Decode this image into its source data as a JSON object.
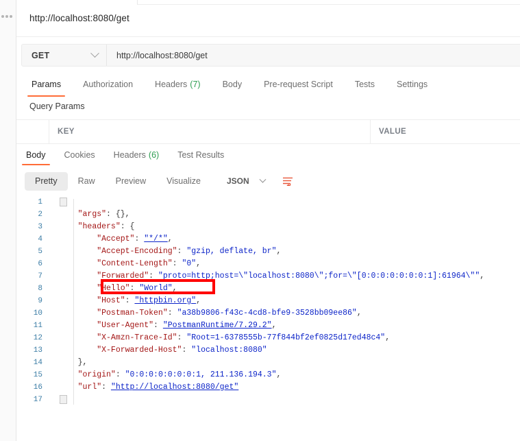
{
  "app": "Postman",
  "request": {
    "title": "http://localhost:8080/get",
    "method": "GET",
    "url": "http://localhost:8080/get",
    "tabs": [
      {
        "label": "Params",
        "active": true
      },
      {
        "label": "Authorization",
        "active": false
      },
      {
        "label": "Headers",
        "count": "(7)",
        "active": false
      },
      {
        "label": "Body",
        "active": false
      },
      {
        "label": "Pre-request Script",
        "active": false
      },
      {
        "label": "Tests",
        "active": false
      },
      {
        "label": "Settings",
        "active": false
      }
    ],
    "query_params_label": "Query Params",
    "params_table": {
      "columns": [
        "KEY",
        "VALUE"
      ],
      "rows": []
    }
  },
  "response": {
    "tabs": [
      {
        "label": "Body",
        "active": true
      },
      {
        "label": "Cookies",
        "active": false
      },
      {
        "label": "Headers",
        "count": "(6)",
        "active": false
      },
      {
        "label": "Test Results",
        "active": false
      }
    ],
    "format_tabs": [
      {
        "label": "Pretty",
        "active": true
      },
      {
        "label": "Raw",
        "active": false
      },
      {
        "label": "Preview",
        "active": false
      },
      {
        "label": "Visualize",
        "active": false
      }
    ],
    "language": "JSON",
    "wrap_icon": "wrap-lines-icon",
    "body_lines": [
      {
        "n": "1",
        "indent": 0,
        "tokens": [
          {
            "t": "p",
            "v": "{"
          }
        ]
      },
      {
        "n": "2",
        "indent": 0,
        "tokens": [
          {
            "t": "p",
            "v": "    "
          },
          {
            "t": "k",
            "v": "\"args\""
          },
          {
            "t": "p",
            "v": ": {},"
          }
        ]
      },
      {
        "n": "3",
        "indent": 0,
        "tokens": [
          {
            "t": "p",
            "v": "    "
          },
          {
            "t": "k",
            "v": "\"headers\""
          },
          {
            "t": "p",
            "v": ": {"
          }
        ]
      },
      {
        "n": "4",
        "indent": 0,
        "tokens": [
          {
            "t": "p",
            "v": "        "
          },
          {
            "t": "k",
            "v": "\"Accept\""
          },
          {
            "t": "p",
            "v": ": "
          },
          {
            "t": "lnk",
            "v": "\"*/*\""
          },
          {
            "t": "p",
            "v": ","
          }
        ]
      },
      {
        "n": "5",
        "indent": 0,
        "tokens": [
          {
            "t": "p",
            "v": "        "
          },
          {
            "t": "k",
            "v": "\"Accept-Encoding\""
          },
          {
            "t": "p",
            "v": ": "
          },
          {
            "t": "s",
            "v": "\"gzip, deflate, br\""
          },
          {
            "t": "p",
            "v": ","
          }
        ]
      },
      {
        "n": "6",
        "indent": 0,
        "tokens": [
          {
            "t": "p",
            "v": "        "
          },
          {
            "t": "k",
            "v": "\"Content-Length\""
          },
          {
            "t": "p",
            "v": ": "
          },
          {
            "t": "s",
            "v": "\"0\""
          },
          {
            "t": "p",
            "v": ","
          }
        ]
      },
      {
        "n": "7",
        "indent": 0,
        "tokens": [
          {
            "t": "p",
            "v": "        "
          },
          {
            "t": "k",
            "v": "\"Forwarded\""
          },
          {
            "t": "p",
            "v": ": "
          },
          {
            "t": "s",
            "v": "\"proto=http;host=\\\"localhost:8080\\\";for=\\\"[0:0:0:0:0:0:0:1]:61964\\\"\""
          },
          {
            "t": "p",
            "v": ","
          }
        ]
      },
      {
        "n": "8",
        "indent": 0,
        "tokens": [
          {
            "t": "p",
            "v": "        "
          },
          {
            "t": "k",
            "v": "\"Hello\""
          },
          {
            "t": "p",
            "v": ": "
          },
          {
            "t": "s",
            "v": "\"World\""
          },
          {
            "t": "p",
            "v": ","
          }
        ]
      },
      {
        "n": "9",
        "indent": 0,
        "tokens": [
          {
            "t": "p",
            "v": "        "
          },
          {
            "t": "k",
            "v": "\"Host\""
          },
          {
            "t": "p",
            "v": ": "
          },
          {
            "t": "lnk",
            "v": "\"httpbin.org\""
          },
          {
            "t": "p",
            "v": ","
          }
        ]
      },
      {
        "n": "10",
        "indent": 0,
        "tokens": [
          {
            "t": "p",
            "v": "        "
          },
          {
            "t": "k",
            "v": "\"Postman-Token\""
          },
          {
            "t": "p",
            "v": ": "
          },
          {
            "t": "s",
            "v": "\"a38b9806-f43c-4cd8-bfe9-3528bb09ee86\""
          },
          {
            "t": "p",
            "v": ","
          }
        ]
      },
      {
        "n": "11",
        "indent": 0,
        "tokens": [
          {
            "t": "p",
            "v": "        "
          },
          {
            "t": "k",
            "v": "\"User-Agent\""
          },
          {
            "t": "p",
            "v": ": "
          },
          {
            "t": "lnk",
            "v": "\"PostmanRuntime/7.29.2\""
          },
          {
            "t": "p",
            "v": ","
          }
        ]
      },
      {
        "n": "12",
        "indent": 0,
        "tokens": [
          {
            "t": "p",
            "v": "        "
          },
          {
            "t": "k",
            "v": "\"X-Amzn-Trace-Id\""
          },
          {
            "t": "p",
            "v": ": "
          },
          {
            "t": "s",
            "v": "\"Root=1-6378555b-77f844bf2ef0825d17ed48c4\""
          },
          {
            "t": "p",
            "v": ","
          }
        ]
      },
      {
        "n": "13",
        "indent": 0,
        "tokens": [
          {
            "t": "p",
            "v": "        "
          },
          {
            "t": "k",
            "v": "\"X-Forwarded-Host\""
          },
          {
            "t": "p",
            "v": ": "
          },
          {
            "t": "s",
            "v": "\"localhost:8080\""
          }
        ]
      },
      {
        "n": "14",
        "indent": 0,
        "tokens": [
          {
            "t": "p",
            "v": "    },"
          }
        ]
      },
      {
        "n": "15",
        "indent": 0,
        "tokens": [
          {
            "t": "p",
            "v": "    "
          },
          {
            "t": "k",
            "v": "\"origin\""
          },
          {
            "t": "p",
            "v": ": "
          },
          {
            "t": "s",
            "v": "\"0:0:0:0:0:0:0:1, 211.136.194.3\""
          },
          {
            "t": "p",
            "v": ","
          }
        ]
      },
      {
        "n": "16",
        "indent": 0,
        "tokens": [
          {
            "t": "p",
            "v": "    "
          },
          {
            "t": "k",
            "v": "\"url\""
          },
          {
            "t": "p",
            "v": ": "
          },
          {
            "t": "lnk",
            "v": "\"http://localhost:8080/get\""
          }
        ]
      },
      {
        "n": "17",
        "indent": 0,
        "tokens": [
          {
            "t": "p",
            "v": "}"
          }
        ]
      }
    ]
  },
  "annotation": {
    "type": "red-rectangle-highlight",
    "target_line": "8",
    "target_text": "\"Hello\": \"World\","
  },
  "colors": {
    "accent": "#ff6c37",
    "count_green": "#2e9e52",
    "json_key": "#a31515",
    "json_string": "#0b23c8",
    "line_number": "#3a7ca5",
    "annotation_red": "#ff0000"
  }
}
